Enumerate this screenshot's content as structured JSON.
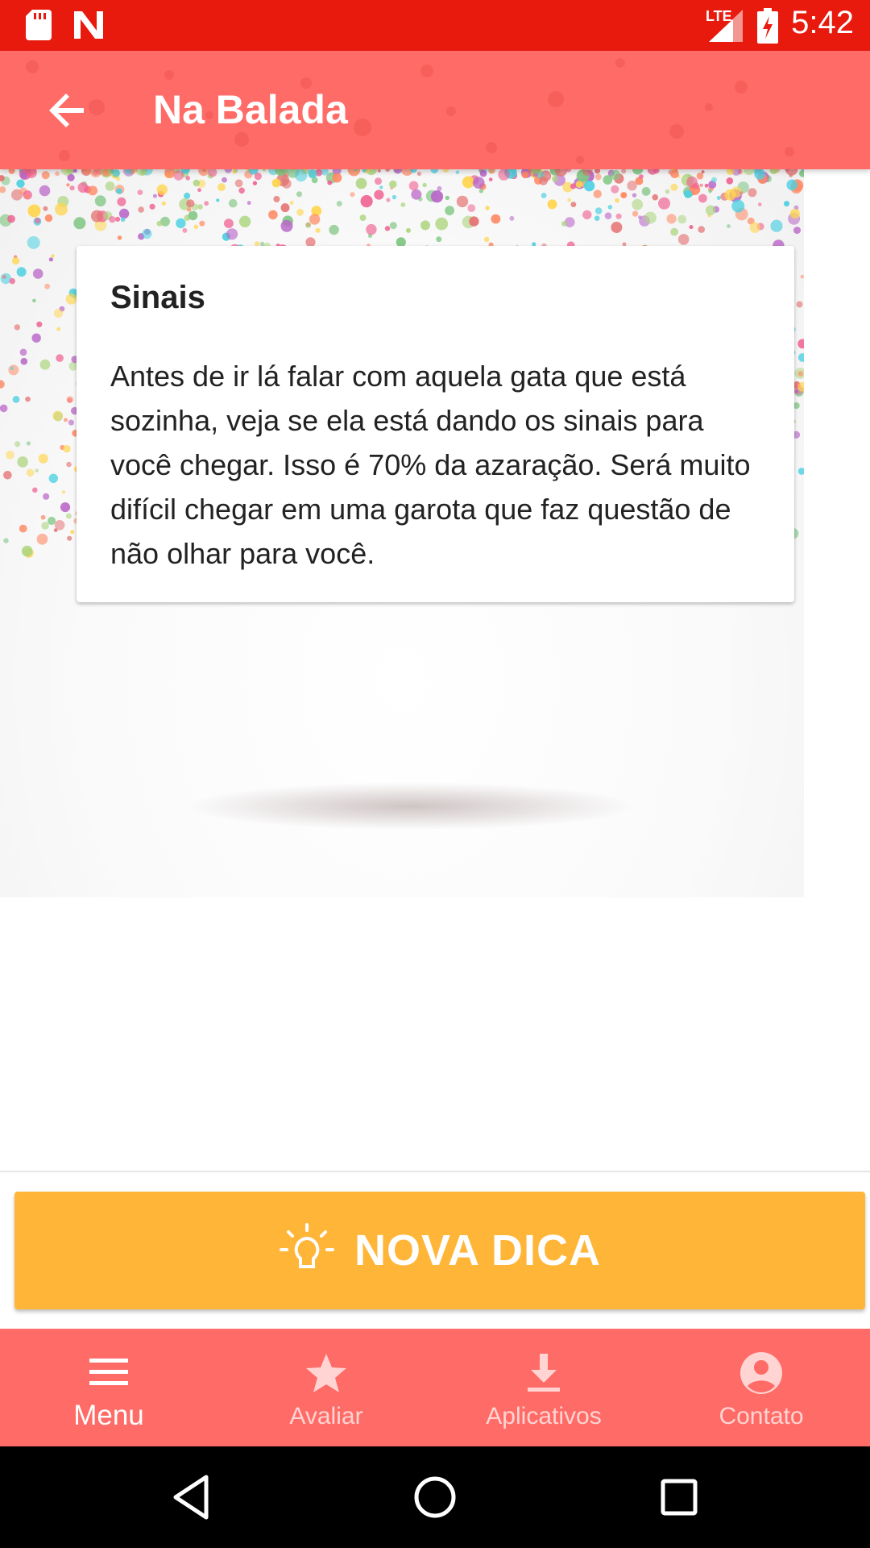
{
  "status_bar": {
    "time": "5:42",
    "network": "LTE",
    "icons": [
      "sd-card-icon",
      "n-logo-icon",
      "signal-icon",
      "battery-charging-icon"
    ]
  },
  "toolbar": {
    "title": "Na Balada",
    "back_icon": "arrow-back-icon",
    "color": "#ff6b66"
  },
  "card": {
    "title": "Sinais",
    "text": "Antes de ir lá falar com aquela gata que está sozinha, veja se ela está dando os sinais para você chegar. Isso é 70% da azaração. Será muito difícil chegar em uma garota que faz questão de não olhar para você."
  },
  "action_button": {
    "label": "NOVA DICA",
    "icon": "lightbulb-icon",
    "color": "#ffb538"
  },
  "bottom_nav": {
    "items": [
      {
        "label": "Menu",
        "icon": "menu-icon",
        "active": true
      },
      {
        "label": "Avaliar",
        "icon": "star-icon",
        "active": false
      },
      {
        "label": "Aplicativos",
        "icon": "download-icon",
        "active": false
      },
      {
        "label": "Contato",
        "icon": "account-icon",
        "active": false
      }
    ]
  },
  "system_nav": {
    "icons": [
      "back-triangle-icon",
      "home-circle-icon",
      "recents-square-icon"
    ]
  }
}
